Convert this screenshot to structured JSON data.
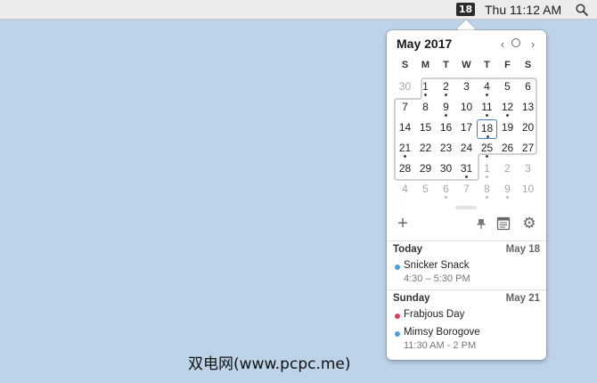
{
  "menubar": {
    "calendar_badge": "18",
    "clock": "Thu 11:12 AM",
    "search_icon": "magnifier-icon"
  },
  "calendar": {
    "month_title": "May 2017",
    "nav": {
      "prev": "‹",
      "next": "›"
    },
    "weekdays": [
      "S",
      "M",
      "T",
      "W",
      "T",
      "F",
      "S"
    ],
    "weeks": [
      [
        {
          "d": "30",
          "out": true,
          "dot": false
        },
        {
          "d": "1",
          "out": false,
          "dot": true
        },
        {
          "d": "2",
          "out": false,
          "dot": true
        },
        {
          "d": "3",
          "out": false,
          "dot": false
        },
        {
          "d": "4",
          "out": false,
          "dot": true
        },
        {
          "d": "5",
          "out": false,
          "dot": false
        },
        {
          "d": "6",
          "out": false,
          "dot": false
        }
      ],
      [
        {
          "d": "7",
          "out": false,
          "dot": false
        },
        {
          "d": "8",
          "out": false,
          "dot": false
        },
        {
          "d": "9",
          "out": false,
          "dot": true
        },
        {
          "d": "10",
          "out": false,
          "dot": false
        },
        {
          "d": "11",
          "out": false,
          "dot": true
        },
        {
          "d": "12",
          "out": false,
          "dot": true
        },
        {
          "d": "13",
          "out": false,
          "dot": false
        }
      ],
      [
        {
          "d": "14",
          "out": false,
          "dot": false
        },
        {
          "d": "15",
          "out": false,
          "dot": false
        },
        {
          "d": "16",
          "out": false,
          "dot": false
        },
        {
          "d": "17",
          "out": false,
          "dot": false
        },
        {
          "d": "18",
          "out": false,
          "dot": true,
          "today": true
        },
        {
          "d": "19",
          "out": false,
          "dot": false
        },
        {
          "d": "20",
          "out": false,
          "dot": false
        }
      ],
      [
        {
          "d": "21",
          "out": false,
          "dot": true
        },
        {
          "d": "22",
          "out": false,
          "dot": false
        },
        {
          "d": "23",
          "out": false,
          "dot": false
        },
        {
          "d": "24",
          "out": false,
          "dot": false
        },
        {
          "d": "25",
          "out": false,
          "dot": true
        },
        {
          "d": "26",
          "out": false,
          "dot": false
        },
        {
          "d": "27",
          "out": false,
          "dot": false
        }
      ],
      [
        {
          "d": "28",
          "out": false,
          "dot": false
        },
        {
          "d": "29",
          "out": false,
          "dot": false
        },
        {
          "d": "30",
          "out": false,
          "dot": false
        },
        {
          "d": "31",
          "out": false,
          "dot": true
        },
        {
          "d": "1",
          "out": true,
          "dot": true
        },
        {
          "d": "2",
          "out": true,
          "dot": false
        },
        {
          "d": "3",
          "out": true,
          "dot": false
        }
      ],
      [
        {
          "d": "4",
          "out": true,
          "dot": false
        },
        {
          "d": "5",
          "out": true,
          "dot": false
        },
        {
          "d": "6",
          "out": true,
          "dot": true
        },
        {
          "d": "7",
          "out": true,
          "dot": false
        },
        {
          "d": "8",
          "out": true,
          "dot": true
        },
        {
          "d": "9",
          "out": true,
          "dot": true
        },
        {
          "d": "10",
          "out": true,
          "dot": false
        }
      ]
    ],
    "today_border_color": "#3b7fd3"
  },
  "toolbar": {
    "add_icon": "plus-icon",
    "pin_icon": "pin-icon",
    "agenda_icon": "agenda-icon",
    "settings_icon": "gear-icon",
    "add_label": "+",
    "settings_label": "⚙"
  },
  "agenda": [
    {
      "heading": "Today",
      "date": "May 18",
      "events": [
        {
          "title": "Snicker Snack",
          "time": "4:30 – 5:30 PM",
          "color": "#4a9fdc"
        }
      ]
    },
    {
      "heading": "Sunday",
      "date": "May 21",
      "events": [
        {
          "title": "Frabjous Day",
          "time": "",
          "color": "#d9435c"
        },
        {
          "title": "Mimsy Borogove",
          "time": "11:30 AM - 2 PM",
          "color": "#4a9fdc"
        }
      ]
    }
  ],
  "watermark": "双电网(www.pcpc.me)"
}
